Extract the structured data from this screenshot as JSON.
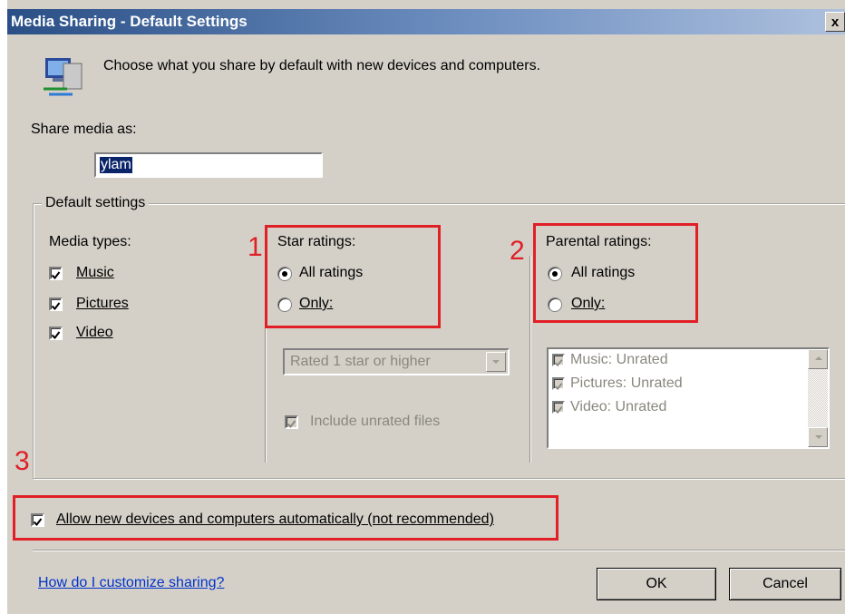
{
  "window": {
    "title": "Media Sharing - Default Settings",
    "close_glyph": "x"
  },
  "header": {
    "description": "Choose what you share by default with new devices and computers.",
    "icon": "network-sharing-icon"
  },
  "share_as": {
    "label": "Share media as:",
    "value": "ylam"
  },
  "default_settings": {
    "legend": "Default settings",
    "media_types": {
      "label": "Media types:",
      "items": [
        {
          "label": "Music",
          "checked": true
        },
        {
          "label": "Pictures",
          "checked": true
        },
        {
          "label": "Video",
          "checked": true
        }
      ]
    },
    "star_ratings": {
      "label": "Star ratings:",
      "options": [
        {
          "label": "All ratings",
          "selected": true
        },
        {
          "label": "Only:",
          "selected": false
        }
      ],
      "combo_value": "Rated 1 star or higher",
      "include_unrated": {
        "label": "Include unrated files",
        "checked": true,
        "enabled": false
      }
    },
    "parental_ratings": {
      "label": "Parental ratings:",
      "options": [
        {
          "label": "All ratings",
          "selected": true
        },
        {
          "label": "Only:",
          "selected": false
        }
      ],
      "list_items": [
        {
          "label": "Music: Unrated",
          "checked": true
        },
        {
          "label": "Pictures: Unrated",
          "checked": true
        },
        {
          "label": "Video: Unrated",
          "checked": true
        }
      ]
    }
  },
  "allow_new_devices": {
    "label": "Allow new devices and computers automatically (not recommended)",
    "checked": true
  },
  "footer": {
    "help_link": "How do I customize sharing?",
    "ok_label": "OK",
    "cancel_label": "Cancel"
  },
  "annotations": {
    "one": "1",
    "two": "2",
    "three": "3",
    "color": "#e01f26"
  }
}
